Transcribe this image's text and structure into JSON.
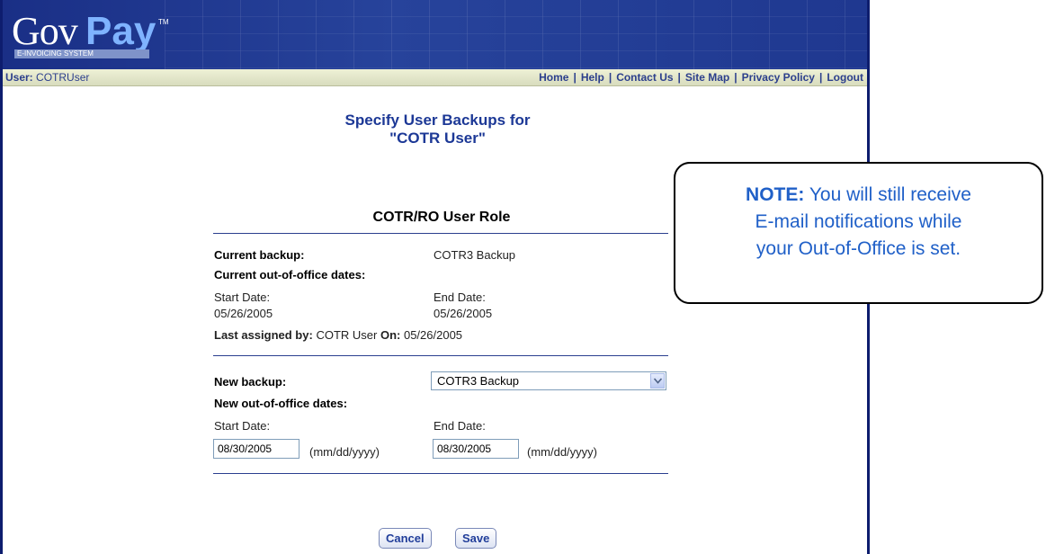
{
  "header": {
    "logo_gov": "Gov",
    "logo_pay": "Pay",
    "logo_tm": "TM",
    "logo_subtitle": "E-INVOICING SYSTEM"
  },
  "navbar": {
    "user_label": "User:",
    "user_name": "COTRUser",
    "links": [
      "Home",
      "Help",
      "Contact Us",
      "Site Map",
      "Privacy Policy",
      "Logout"
    ]
  },
  "page": {
    "title_line1": "Specify User Backups for",
    "title_line2": "\"COTR User\""
  },
  "role": {
    "title": "COTR/RO User Role",
    "current_backup_label": "Current backup:",
    "current_backup_value": "COTR3 Backup",
    "current_dates_label": "Current out-of-office dates:",
    "start_label": "Start Date:",
    "start_value": "05/26/2005",
    "end_label": "End Date:",
    "end_value": "05/26/2005",
    "assigned_by_label": "Last assigned by:",
    "assigned_by_value": "COTR User",
    "on_label": "On:",
    "on_value": "05/26/2005"
  },
  "new_backup": {
    "label": "New backup:",
    "selected": "COTR3 Backup",
    "dates_label": "New out-of-office dates:",
    "start_label": "Start Date:",
    "start_value": "08/30/2005",
    "end_label": "End Date:",
    "end_value": "08/30/2005",
    "format_hint": "(mm/dd/yyyy)"
  },
  "buttons": {
    "cancel": "Cancel",
    "save": "Save"
  },
  "note": {
    "prefix": "NOTE:",
    "text_line1": " You will still receive",
    "text_line2": "E-mail notifications while",
    "text_line3": "your Out-of-Office is set."
  }
}
